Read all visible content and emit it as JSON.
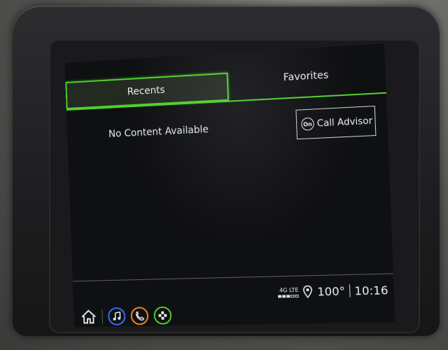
{
  "tabs": {
    "recents": "Recents",
    "favorites": "Favorites"
  },
  "content": {
    "empty_message": "No Content Available"
  },
  "actions": {
    "call_advisor": "Call Advisor",
    "onstar_badge": "On"
  },
  "status": {
    "network": "4G LTE",
    "signal_level": 3,
    "signal_max": 5,
    "temperature": "100°",
    "time": "10:16"
  },
  "dock": {
    "items": [
      "home-icon",
      "music-icon",
      "phone-icon",
      "apps-icon"
    ]
  },
  "colors": {
    "accent_green": "#4fd12a",
    "music_blue": "#3a6cff",
    "phone_orange": "#f08a1c",
    "apps_green": "#4fd12a"
  }
}
